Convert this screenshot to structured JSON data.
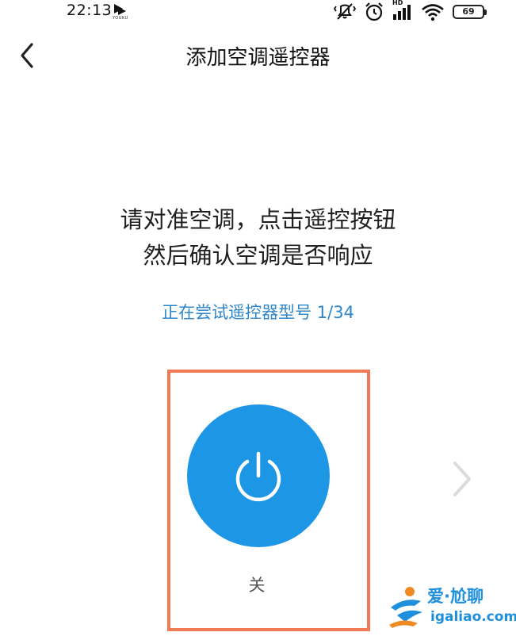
{
  "status_bar": {
    "time": "22:13",
    "app_label": "YOUKU",
    "network_label": "HD",
    "battery_level": "69",
    "icons": [
      "youku-app-icon",
      "mute-vibrate-icon",
      "alarm-icon",
      "signal-icon",
      "wifi-icon",
      "battery-icon"
    ]
  },
  "nav": {
    "title": "添加空调遥控器",
    "back_icon": "chevron-left-icon"
  },
  "instructions": {
    "line1": "请对准空调，点击遥控按钮",
    "line2": "然后确认空调是否响应"
  },
  "model_progress": "正在尝试遥控器型号 1/34",
  "remote": {
    "power_icon": "power-icon",
    "power_label": "关",
    "next_icon": "chevron-right-icon"
  },
  "watermark": {
    "name": "爱·尬聊",
    "url": "igaliao.com"
  },
  "colors": {
    "accent_blue": "#1e96e6",
    "progress_text": "#2e86c8",
    "highlight_border": "#ef7b55",
    "watermark_blue": "#1f8fdd",
    "watermark_orange": "#f08a24"
  }
}
